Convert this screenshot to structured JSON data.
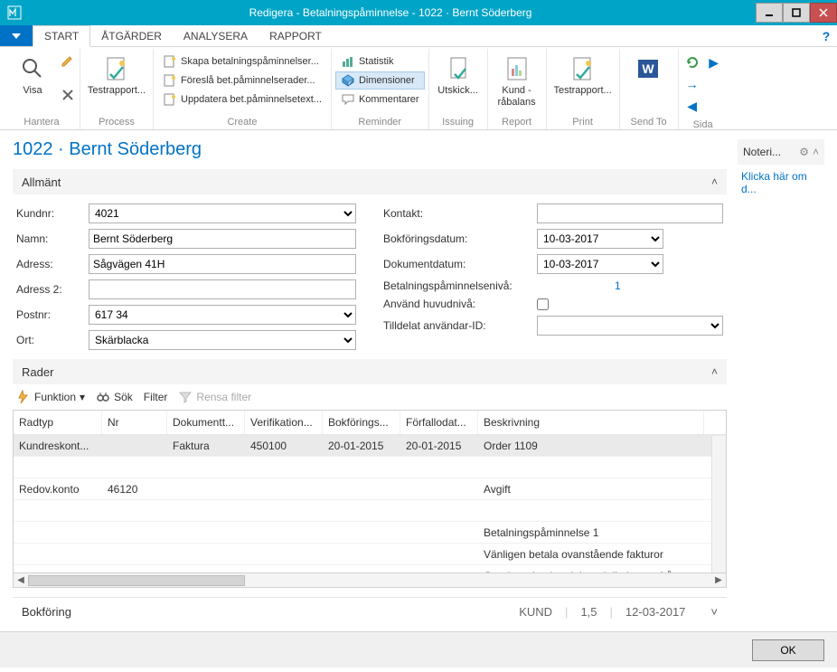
{
  "window": {
    "title": "Redigera - Betalningspåminnelse - 1022 · Bernt Söderberg"
  },
  "tabs": [
    "START",
    "ÅTGÄRDER",
    "ANALYSERA",
    "RAPPORT"
  ],
  "ribbon": {
    "hantera": {
      "label": "Hantera",
      "visa": "Visa"
    },
    "process": {
      "label": "Process",
      "testrapport": "Testrapport..."
    },
    "create": {
      "label": "Create",
      "items": [
        "Skapa betalningspåminnelser...",
        "Föreslå bet.påminnelserader...",
        "Uppdatera bet.påminnelsetext..."
      ]
    },
    "reminder": {
      "label": "Reminder",
      "items": [
        "Statistik",
        "Dimensioner",
        "Kommentarer"
      ]
    },
    "issuing": {
      "label": "Issuing",
      "utskick": "Utskick..."
    },
    "report": {
      "label": "Report",
      "kund": "Kund - råbalans"
    },
    "print": {
      "label": "Print",
      "testrapport": "Testrapport..."
    },
    "sendto": {
      "label": "Send To"
    },
    "sida": {
      "label": "Sida"
    }
  },
  "pageTitle": "1022 · Bernt Söderberg",
  "sections": {
    "allmant": "Allmänt",
    "rader": "Rader",
    "bokforing": "Bokföring",
    "noteringar": "Noteri..."
  },
  "form": {
    "labels": {
      "kundnr": "Kundnr:",
      "namn": "Namn:",
      "adress": "Adress:",
      "adress2": "Adress 2:",
      "postnr": "Postnr:",
      "ort": "Ort:",
      "kontakt": "Kontakt:",
      "bokforingsdatum": "Bokföringsdatum:",
      "dokumentdatum": "Dokumentdatum:",
      "niva": "Betalningspåminnelsenivå:",
      "huvudniva": "Använd huvudnivå:",
      "anvandarid": "Tilldelat användar-ID:"
    },
    "values": {
      "kundnr": "4021",
      "namn": "Bernt Söderberg",
      "adress": "Sågvägen 41H",
      "adress2": "",
      "postnr": "617 34",
      "ort": "Skärblacka",
      "kontakt": "",
      "bokforingsdatum": "10-03-2017",
      "dokumentdatum": "10-03-2017",
      "niva": "1",
      "anvandarid": ""
    }
  },
  "toolbar": {
    "funktion": "Funktion",
    "sok": "Sök",
    "filter": "Filter",
    "rensa": "Rensa filter"
  },
  "grid": {
    "headers": [
      "Radtyp",
      "Nr",
      "Dokumentt...",
      "Verifikation...",
      "Bokförings...",
      "Förfallodat...",
      "Beskrivning"
    ],
    "rows": [
      {
        "radtyp": "Kundreskont...",
        "nr": "",
        "dokumenttyp": "Faktura",
        "verifikation": "450100",
        "bokforings": "20-01-2015",
        "forfallodat": "20-01-2015",
        "beskrivning": "Order 1109",
        "sel": true
      },
      {
        "radtyp": "",
        "nr": "",
        "dokumenttyp": "",
        "verifikation": "",
        "bokforings": "",
        "forfallodat": "",
        "beskrivning": ""
      },
      {
        "radtyp": "Redov.konto",
        "nr": "46120",
        "dokumenttyp": "",
        "verifikation": "",
        "bokforings": "",
        "forfallodat": "",
        "beskrivning": "Avgift"
      },
      {
        "radtyp": "",
        "nr": "",
        "dokumenttyp": "",
        "verifikation": "",
        "bokforings": "",
        "forfallodat": "",
        "beskrivning": ""
      },
      {
        "radtyp": "",
        "nr": "",
        "dokumenttyp": "",
        "verifikation": "",
        "bokforings": "",
        "forfallodat": "",
        "beskrivning": "Betalningspåminnelse 1"
      },
      {
        "radtyp": "",
        "nr": "",
        "dokumenttyp": "",
        "verifikation": "",
        "bokforings": "",
        "forfallodat": "",
        "beskrivning": "Vänligen betala ovanstående fakturor"
      },
      {
        "radtyp": "",
        "nr": "",
        "dokumenttyp": "",
        "verifikation": "",
        "bokforings": "",
        "forfallodat": "",
        "beskrivning": "Om du redan betalt ber vi dig bortse frå"
      }
    ]
  },
  "bokforing": {
    "kund": "KUND",
    "v1": "1,5",
    "date": "12-03-2017"
  },
  "sidebar": {
    "link": "Klicka här om d..."
  },
  "footer": {
    "ok": "OK"
  }
}
